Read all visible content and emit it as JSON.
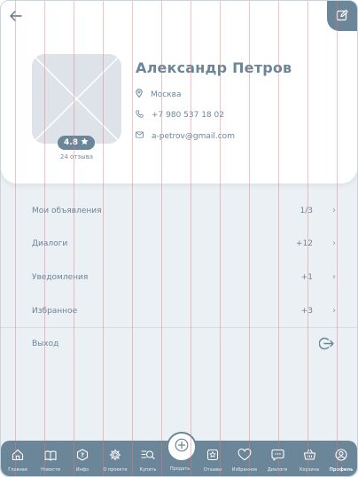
{
  "profile": {
    "name": "Александр Петров",
    "rating": "4.8",
    "reviews": "24 отзыва",
    "city": "Москва",
    "phone": "+7 980 537 18 02",
    "email": "a-petrov@gmail.com"
  },
  "menu": {
    "items": [
      {
        "label": "Мои объявления",
        "count": "1/3"
      },
      {
        "label": "Диалоги",
        "count": "+12"
      },
      {
        "label": "Уведомления",
        "count": "+1"
      },
      {
        "label": "Избранное",
        "count": "+3"
      }
    ],
    "logout": "Выход"
  },
  "nav": {
    "items": [
      {
        "label": "Главная",
        "icon": "home-icon"
      },
      {
        "label": "Новости",
        "icon": "news-icon"
      },
      {
        "label": "Инфо",
        "icon": "help-icon"
      },
      {
        "label": "О проекте",
        "icon": "gear-icon"
      },
      {
        "label": "Купить",
        "icon": "search-icon"
      },
      {
        "label": "Продать",
        "icon": "plus-icon"
      },
      {
        "label": "Отзывы",
        "icon": "star-icon"
      },
      {
        "label": "Избранное",
        "icon": "heart-icon"
      },
      {
        "label": "Диалоги",
        "icon": "chat-icon"
      },
      {
        "label": "Корзина",
        "icon": "cart-icon"
      },
      {
        "label": "Профиль",
        "icon": "user-icon"
      }
    ]
  },
  "colors": {
    "accent": "#6b8599",
    "background": "#eaf0f4",
    "card": "#ffffff"
  }
}
